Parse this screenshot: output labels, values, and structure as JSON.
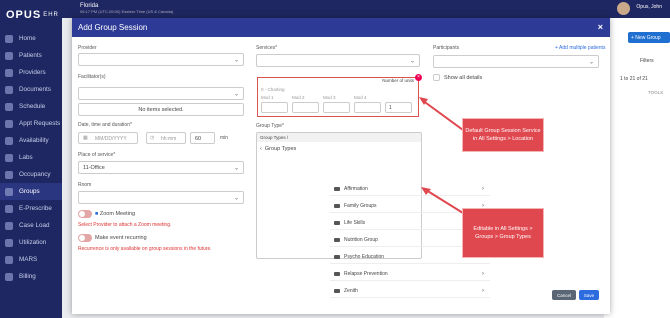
{
  "app": {
    "logo": "OPUS",
    "logo_sub": "EHR",
    "location": "Florida",
    "timestamp": "06:17 PM (UTC-05:00) Eastern Time (US & Canada)",
    "user": "Opus, John"
  },
  "sidebar": {
    "items": [
      {
        "label": "Home"
      },
      {
        "label": "Patients"
      },
      {
        "label": "Providers"
      },
      {
        "label": "Documents"
      },
      {
        "label": "Schedule"
      },
      {
        "label": "Appt Requests"
      },
      {
        "label": "Availability"
      },
      {
        "label": "Labs"
      },
      {
        "label": "Occupancy"
      },
      {
        "label": "Groups"
      },
      {
        "label": "E-Prescribe"
      },
      {
        "label": "Case Load"
      },
      {
        "label": "Utilization"
      },
      {
        "label": "MARS"
      },
      {
        "label": "Billing"
      }
    ],
    "active": "Groups"
  },
  "background": {
    "new_group": "+ New Group",
    "filters": "Filters",
    "pager": "1 to 21 of 21",
    "tools": "TOOLS"
  },
  "modal": {
    "title": "Add Group Session",
    "close": "×",
    "provider_label": "Provider",
    "facilitators_label": "Facilitator(s)",
    "no_items": "No items selected.",
    "datetime_label": "Date, time and duration*",
    "date_placeholder": "MM/DD/YYYY",
    "time_placeholder": "hh:mm",
    "duration": "60",
    "min": "min",
    "pos_label": "Place of service*",
    "pos_value": "11-Office",
    "room_label": "Room",
    "zoom_label": "Zoom Meeting",
    "zoom_warning": "Select Provider to attach a Zoom meeting.",
    "recurring_label": "Make event recurring",
    "recurring_warning": "Recurrence is only available on group sessions in the future.",
    "services_label": "Services*",
    "number_of_units": "Number of units",
    "service_name": "0 - Charting",
    "mods": [
      "Mod 1",
      "Mod 2",
      "Mod 3",
      "Mod 4"
    ],
    "units_value": "1",
    "group_type_label": "Group Type*",
    "group_types_crumb": "Group Types  /",
    "group_types_header": "Group Types",
    "group_types": [
      "Affirmation",
      "Family Groups",
      "Life Skills",
      "Nutrition Group",
      "Psycho Education",
      "Relapse Prevention",
      "Zenith"
    ],
    "participants_label": "Participants",
    "add_multiple": "+ Add multiple patients",
    "show_all": "Show all details",
    "cancel": "Cancel",
    "save": "Save"
  },
  "callouts": {
    "one": "Default Group Session Service in All Settings > Location",
    "two": "Editable in All Settings > Groups > Group Types"
  },
  "colors": {
    "sidebar": "#1e2761",
    "header": "#2d3b97",
    "accent": "#1f6fd0",
    "callout": "#e0484f"
  }
}
